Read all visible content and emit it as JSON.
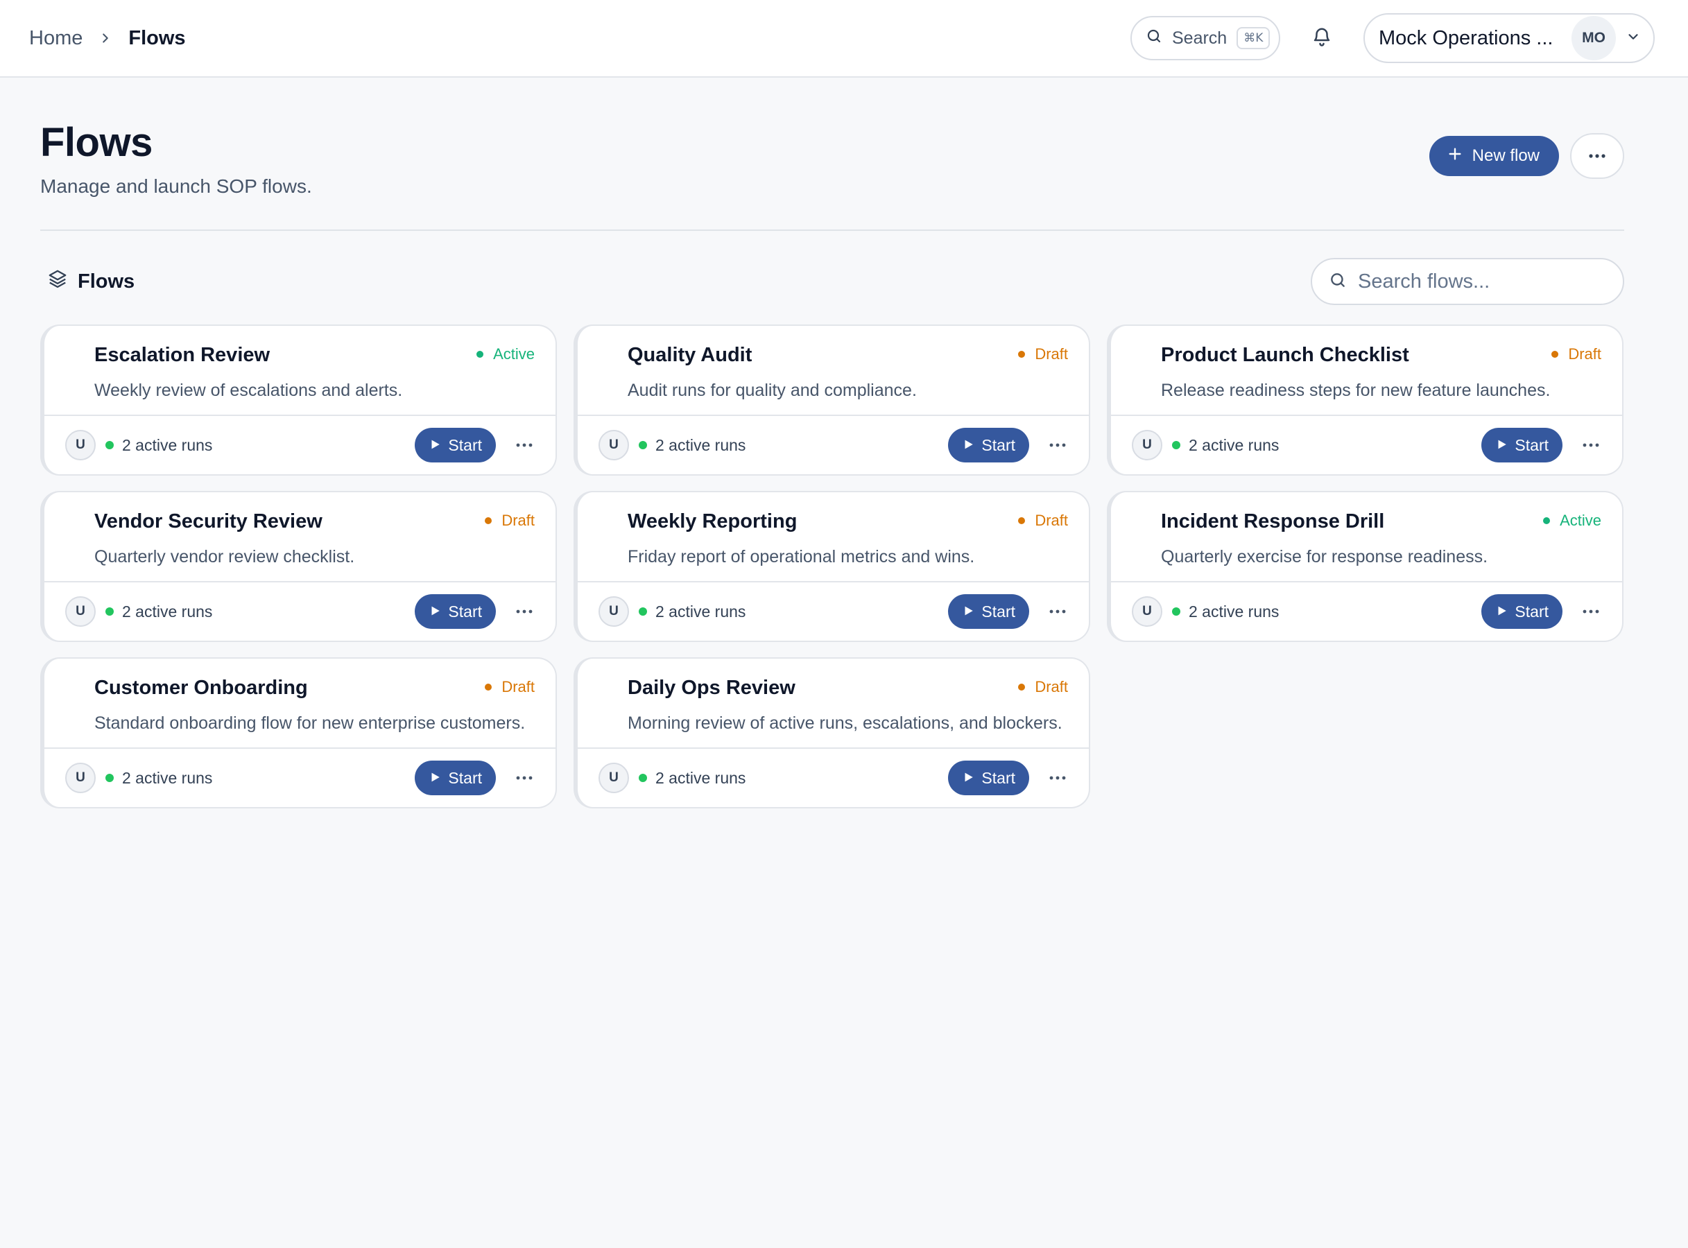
{
  "breadcrumb": {
    "home": "Home",
    "current": "Flows"
  },
  "topbar": {
    "search_label": "Search",
    "shortcut": "⌘K",
    "org_name": "Mock Operations ...",
    "org_initials": "MO"
  },
  "header": {
    "title": "Flows",
    "subtitle": "Manage and launch SOP flows.",
    "new_flow_label": "New flow"
  },
  "section": {
    "title": "Flows",
    "search_placeholder": "Search flows..."
  },
  "colors": {
    "primary": "#35589e",
    "active": "#16b37a",
    "draft": "#d97706",
    "run_dot": "#22c55e"
  },
  "flows": [
    {
      "title": "Escalation Review",
      "status": "Active",
      "description": "Weekly review of escalations and alerts.",
      "user": "U",
      "runs": "2 active runs",
      "start": "Start"
    },
    {
      "title": "Quality Audit",
      "status": "Draft",
      "description": "Audit runs for quality and compliance.",
      "user": "U",
      "runs": "2 active runs",
      "start": "Start"
    },
    {
      "title": "Product Launch Checklist",
      "status": "Draft",
      "description": "Release readiness steps for new feature launches.",
      "user": "U",
      "runs": "2 active runs",
      "start": "Start"
    },
    {
      "title": "Vendor Security Review",
      "status": "Draft",
      "description": "Quarterly vendor review checklist.",
      "user": "U",
      "runs": "2 active runs",
      "start": "Start"
    },
    {
      "title": "Weekly Reporting",
      "status": "Draft",
      "description": "Friday report of operational metrics and wins.",
      "user": "U",
      "runs": "2 active runs",
      "start": "Start"
    },
    {
      "title": "Incident Response Drill",
      "status": "Active",
      "description": "Quarterly exercise for response readiness.",
      "user": "U",
      "runs": "2 active runs",
      "start": "Start"
    },
    {
      "title": "Customer Onboarding",
      "status": "Draft",
      "description": "Standard onboarding flow for new enterprise customers.",
      "user": "U",
      "runs": "2 active runs",
      "start": "Start"
    },
    {
      "title": "Daily Ops Review",
      "status": "Draft",
      "description": "Morning review of active runs, escalations, and blockers.",
      "user": "U",
      "runs": "2 active runs",
      "start": "Start"
    }
  ]
}
